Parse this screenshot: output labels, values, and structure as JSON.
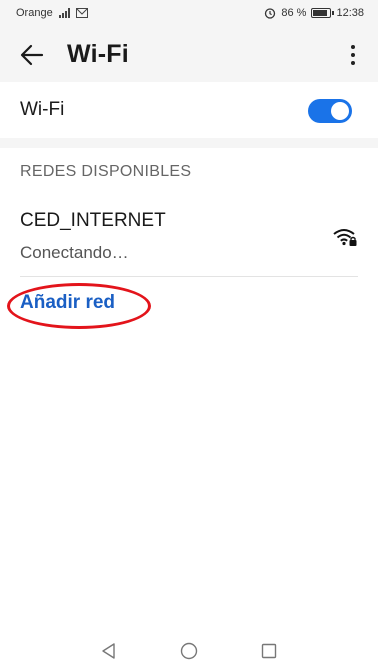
{
  "status_bar": {
    "carrier": "Orange",
    "battery": "86 %",
    "time": "12:38"
  },
  "app_bar": {
    "title": "Wi-Fi"
  },
  "wifi_toggle": {
    "label": "Wi-Fi",
    "on": true
  },
  "networks_section": {
    "header": "REDES DISPONIBLES",
    "items": [
      {
        "ssid": "CED_INTERNET",
        "status": "Conectando…"
      }
    ]
  },
  "add_network": {
    "label": "Añadir red"
  },
  "colors": {
    "accent": "#1a73e8",
    "link": "#1a5fc4",
    "annotation": "#e3141b"
  },
  "icons": [
    "arrow-back-icon",
    "more-vert-icon",
    "wifi-locked-icon",
    "nav-back-icon",
    "nav-home-icon",
    "nav-recent-icon"
  ]
}
